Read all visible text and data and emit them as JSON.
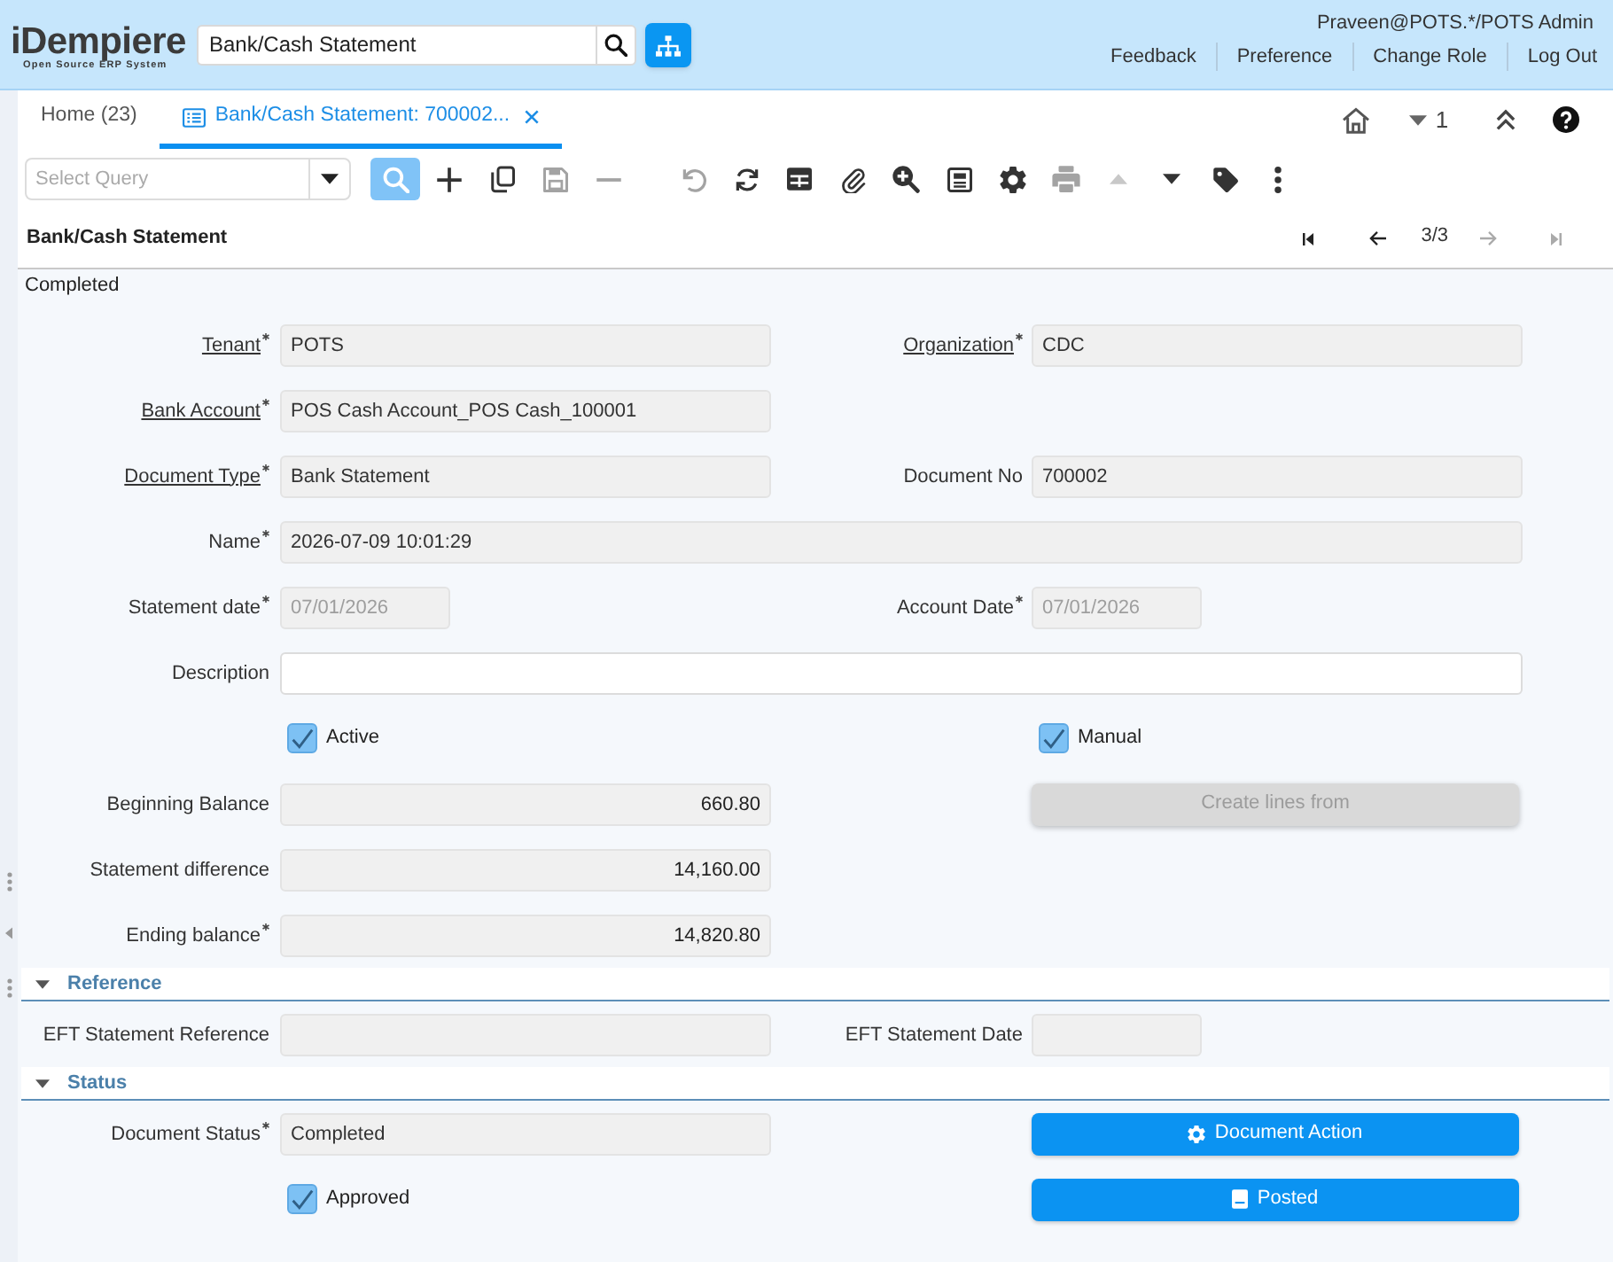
{
  "header": {
    "logo": {
      "name": "iDempiere",
      "tagline": "Open Source ERP System"
    },
    "search": {
      "value": "Bank/Cash Statement"
    },
    "user": "Praveen@POTS.*/POTS Admin",
    "links": [
      "Feedback",
      "Preference",
      "Change Role",
      "Log Out"
    ]
  },
  "tabs": [
    {
      "label": "Home (23)",
      "selected": false,
      "closable": false
    },
    {
      "label": "Bank/Cash Statement: 700002...",
      "selected": true,
      "closable": true
    }
  ],
  "tab_tools": {
    "count": "1"
  },
  "toolbar": {
    "query": {
      "placeholder": "Select Query"
    },
    "buttons": [
      {
        "kind": "find",
        "disabled": false
      },
      {
        "kind": "new",
        "disabled": false
      },
      {
        "kind": "copy",
        "disabled": false
      },
      {
        "kind": "save",
        "disabled": true
      },
      {
        "kind": "delete",
        "disabled": true
      },
      {
        "kind": "undo",
        "disabled": true
      },
      {
        "kind": "refresh",
        "disabled": false
      },
      {
        "kind": "grid",
        "disabled": false
      },
      {
        "kind": "attach",
        "disabled": false
      },
      {
        "kind": "zoom",
        "disabled": false
      },
      {
        "kind": "report",
        "disabled": false
      },
      {
        "kind": "settings",
        "disabled": false
      },
      {
        "kind": "print",
        "disabled": true
      },
      {
        "kind": "up",
        "disabled": true
      },
      {
        "kind": "down",
        "disabled": false
      },
      {
        "kind": "tag",
        "disabled": false
      },
      {
        "kind": "more",
        "disabled": false
      }
    ]
  },
  "record": {
    "title": "Bank/Cash Statement",
    "position": "3/3",
    "nav": [
      {
        "kind": "first",
        "disabled": false
      },
      {
        "kind": "previous",
        "disabled": false
      },
      {
        "kind": "next",
        "disabled": true
      },
      {
        "kind": "last",
        "disabled": true
      }
    ]
  },
  "form": {
    "status": "Completed",
    "rows": [
      [
        {
          "kind": "text",
          "label": "Tenant",
          "link": true,
          "mandatory": true,
          "readonly": true,
          "value": "POTS"
        },
        {
          "kind": "text",
          "label": "Organization",
          "link": true,
          "mandatory": true,
          "readonly": true,
          "value": "CDC"
        }
      ],
      [
        {
          "kind": "text",
          "label": "Bank Account",
          "link": true,
          "mandatory": true,
          "readonly": true,
          "value": "POS Cash Account_POS Cash_100001"
        }
      ],
      [
        {
          "kind": "text",
          "label": "Document Type",
          "link": true,
          "mandatory": true,
          "readonly": true,
          "value": "Bank Statement"
        },
        {
          "kind": "text",
          "label": "Document No",
          "link": false,
          "mandatory": false,
          "readonly": true,
          "value": "700002"
        }
      ],
      [
        {
          "kind": "text",
          "label": "Name",
          "link": false,
          "mandatory": true,
          "readonly": true,
          "wide": true,
          "value": "2026-07-09 10:01:29"
        }
      ],
      [
        {
          "kind": "date",
          "label": "Statement date",
          "link": false,
          "mandatory": true,
          "readonly": true,
          "value": "07/01/2026"
        },
        {
          "kind": "date",
          "label": "Account Date",
          "link": false,
          "mandatory": true,
          "readonly": true,
          "value": "07/01/2026"
        }
      ],
      [
        {
          "kind": "text",
          "label": "Description",
          "link": false,
          "mandatory": false,
          "readonly": false,
          "wide": true
        }
      ],
      [
        {
          "kind": "checkbox",
          "label": "Active",
          "checked": true
        },
        {
          "kind": "checkbox",
          "label": "Manual",
          "checked": true
        }
      ],
      [
        {
          "kind": "amount",
          "label": "Beginning Balance",
          "link": false,
          "mandatory": false,
          "readonly": true,
          "value": "660.80"
        },
        {
          "kind": "button",
          "label": "Create lines from",
          "disabled": true
        }
      ],
      [
        {
          "kind": "amount",
          "label": "Statement difference",
          "link": false,
          "mandatory": false,
          "readonly": true,
          "value": "14,160.00"
        }
      ],
      [
        {
          "kind": "amount",
          "label": "Ending balance",
          "link": false,
          "mandatory": true,
          "readonly": true,
          "value": "14,820.80"
        }
      ]
    ],
    "sections": [
      {
        "title": "Reference",
        "expanded": true,
        "rows": [
          [
            {
              "kind": "text",
              "label": "EFT Statement Reference",
              "link": false,
              "mandatory": false,
              "readonly": true
            },
            {
              "kind": "date",
              "label": "EFT Statement Date",
              "link": false,
              "mandatory": false,
              "readonly": true
            }
          ]
        ]
      },
      {
        "title": "Status",
        "expanded": true,
        "rows": [
          [
            {
              "kind": "text",
              "label": "Document Status",
              "link": false,
              "mandatory": true,
              "readonly": true,
              "value": "Completed"
            },
            {
              "kind": "action",
              "label": "Document Action",
              "disabled": false
            }
          ],
          [
            {
              "kind": "checkbox",
              "label": "Approved",
              "checked": true
            },
            {
              "kind": "posting",
              "label": "Posted",
              "disabled": false
            }
          ]
        ]
      }
    ]
  }
}
